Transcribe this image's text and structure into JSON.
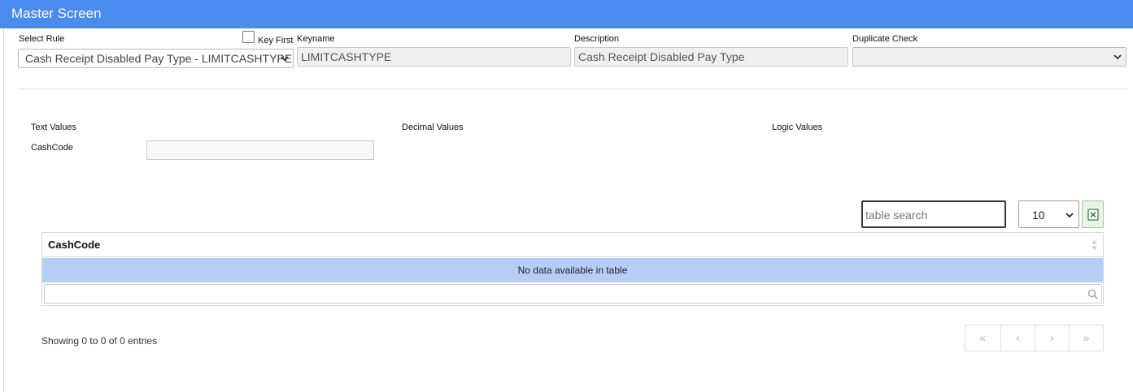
{
  "window": {
    "title": "Master Screen"
  },
  "form": {
    "select_rule_label": "Select Rule",
    "select_rule_value": "Cash Receipt Disabled Pay Type - LIMITCASHTYPE",
    "key_first_label": "Key First",
    "key_first_checked": false,
    "keyname_label": "Keyname",
    "keyname_value": "LIMITCASHTYPE",
    "description_label": "Description",
    "description_value": "Cash Receipt Disabled Pay Type",
    "duplicate_check_label": "Duplicate Check",
    "duplicate_check_value": ""
  },
  "sections": {
    "text_values": "Text Values",
    "decimal_values": "Decimal Values",
    "logic_values": "Logic Values",
    "cashcode_label": "CashCode",
    "cashcode_value": ""
  },
  "table": {
    "search_placeholder": "table search",
    "page_size": "10",
    "columns": [
      "CashCode"
    ],
    "empty_message": "No data available in table",
    "info": "Showing 0 to 0 of 0 entries",
    "pager": [
      "«",
      "‹",
      "›",
      "»"
    ]
  },
  "icons": {
    "excel": "excel-export-icon",
    "search": "search-icon",
    "chevron": "chevron-down-icon",
    "sort": "sort-icon"
  },
  "colors": {
    "titlebar": "#4a8bf0",
    "empty_row": "#b6cdf5",
    "excel_green": "#2e7d32"
  }
}
